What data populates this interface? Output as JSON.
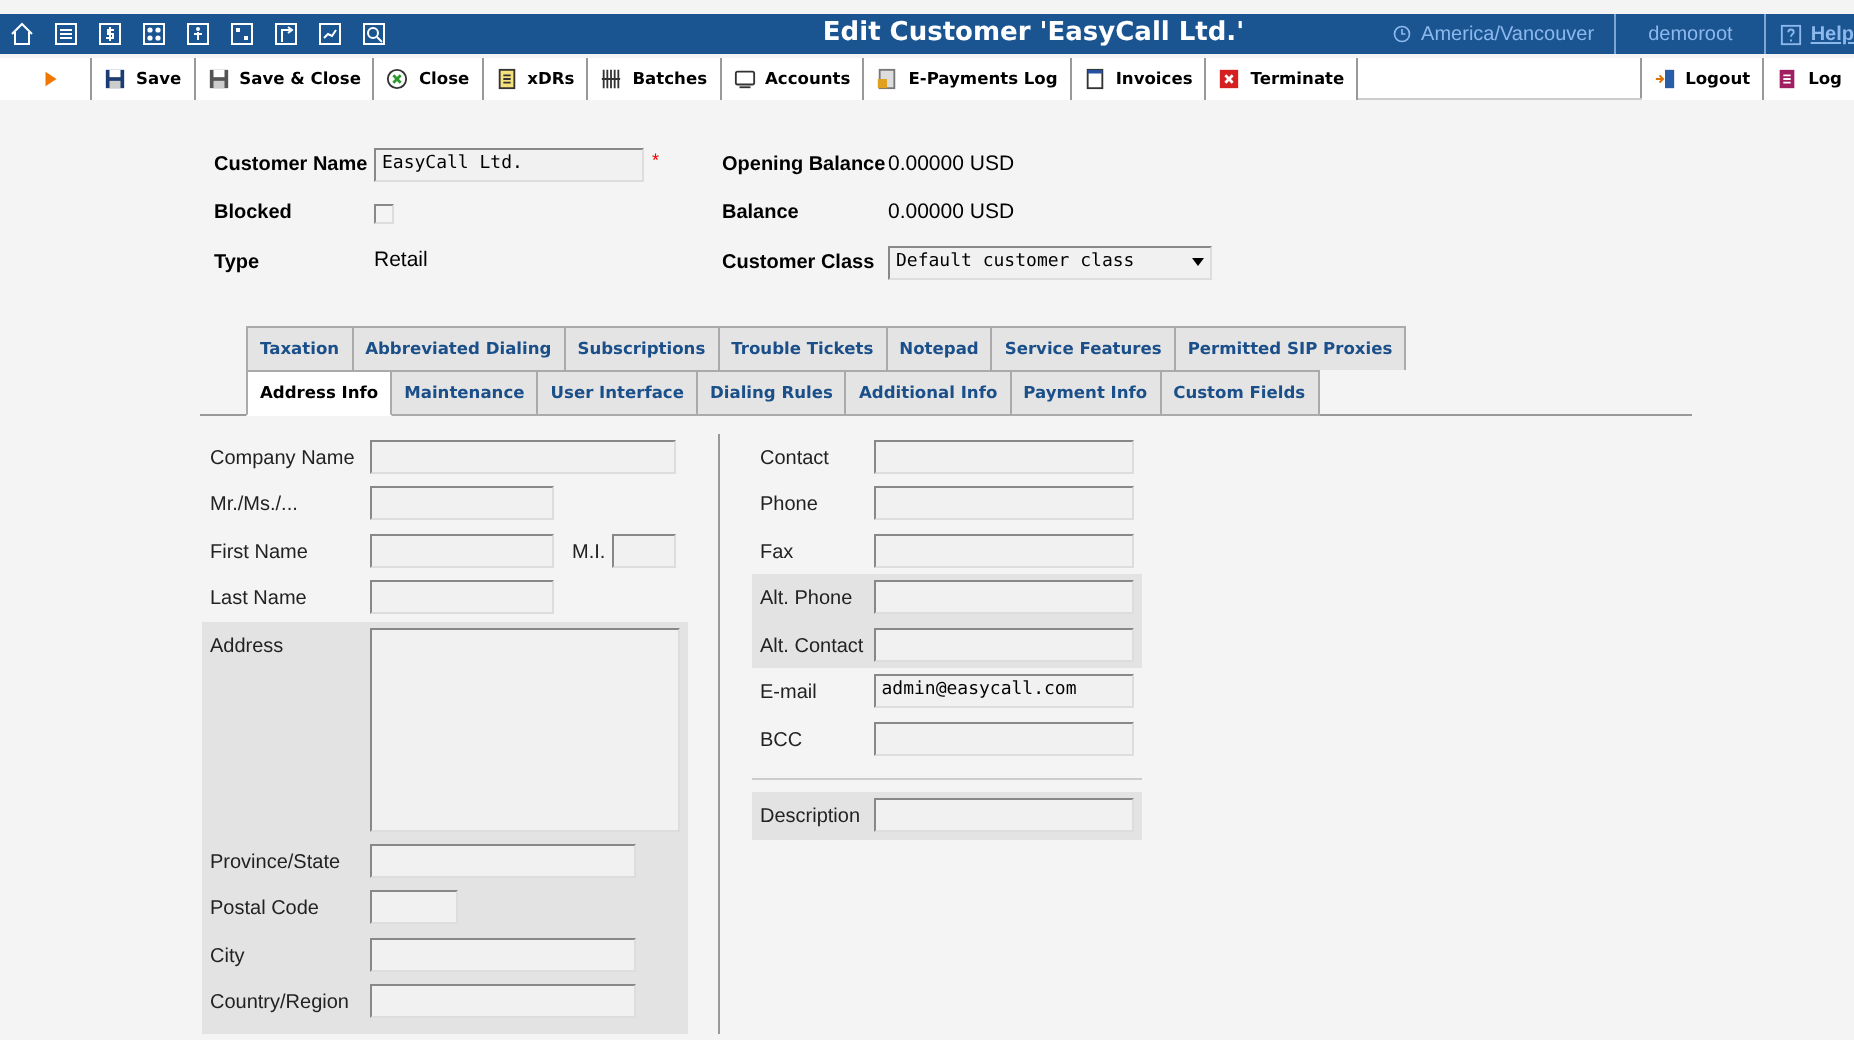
{
  "nav_icons": [
    {
      "kind": "home"
    },
    {
      "kind": "list"
    },
    {
      "kind": "dollar"
    },
    {
      "kind": "grid"
    },
    {
      "kind": "person"
    },
    {
      "kind": "nodes"
    },
    {
      "kind": "arrow"
    },
    {
      "kind": "chart"
    },
    {
      "kind": "search"
    }
  ],
  "title": "Edit Customer 'EasyCall Ltd.'",
  "timezone": "America/Vancouver",
  "user": "demoroot",
  "help": "Help",
  "toolbar": [
    {
      "kind": "play"
    },
    {
      "kind": "save",
      "label": "Save"
    },
    {
      "kind": "saveclose",
      "label": "Save & Close"
    },
    {
      "kind": "close",
      "label": "Close"
    },
    {
      "kind": "doc",
      "label": "xDRs"
    },
    {
      "kind": "batches",
      "label": "Batches"
    },
    {
      "kind": "accounts",
      "label": "Accounts"
    },
    {
      "kind": "payments",
      "label": "E-Payments Log"
    },
    {
      "kind": "invoice",
      "label": "Invoices"
    },
    {
      "kind": "terminate",
      "label": "Terminate"
    }
  ],
  "toolbar_right": [
    {
      "kind": "logout",
      "label": "Logout"
    },
    {
      "kind": "log",
      "label": "Log"
    }
  ],
  "header": {
    "customer_name": {
      "label": "Customer Name",
      "value": "EasyCall Ltd.",
      "required_mark": "*"
    },
    "blocked": {
      "label": "Blocked",
      "checked": false
    },
    "type": {
      "label": "Type",
      "value": "Retail"
    },
    "opening_balance": {
      "label": "Opening Balance",
      "value": "0.00000 USD"
    },
    "balance": {
      "label": "Balance",
      "value": "0.00000 USD"
    },
    "customer_class": {
      "label": "Customer Class",
      "value": "Default customer class"
    }
  },
  "tab_rows": [
    [
      {
        "label": "Taxation",
        "selected": false
      },
      {
        "label": "Abbreviated Dialing",
        "selected": false
      },
      {
        "label": "Subscriptions",
        "selected": false
      },
      {
        "label": "Trouble Tickets",
        "selected": false
      },
      {
        "label": "Notepad",
        "selected": false
      },
      {
        "label": "Service Features",
        "selected": false
      },
      {
        "label": "Permitted SIP Proxies",
        "selected": false
      }
    ],
    [
      {
        "label": "Address Info",
        "selected": true
      },
      {
        "label": "Maintenance",
        "selected": false
      },
      {
        "label": "User Interface",
        "selected": false
      },
      {
        "label": "Dialing Rules",
        "selected": false
      },
      {
        "label": "Additional Info",
        "selected": false
      },
      {
        "label": "Payment Info",
        "selected": false
      },
      {
        "label": "Custom Fields",
        "selected": false
      }
    ]
  ],
  "left_fields": [
    {
      "label": "Company Name",
      "kind": "wide",
      "shaded": false
    },
    {
      "label": "Mr./Ms./...",
      "kind": "medium",
      "shaded": false
    },
    {
      "label": "First Name",
      "kind": "medium",
      "shaded": false,
      "extra": {
        "label": "M.I.",
        "kind": "short"
      }
    },
    {
      "label": "Last Name",
      "kind": "medium",
      "shaded": false
    },
    {
      "label": "Address",
      "kind": "textarea",
      "shaded": true
    },
    {
      "label": "Province/State",
      "kind": "long",
      "shaded": true
    },
    {
      "label": "Postal Code",
      "kind": "tiny",
      "shaded": true
    },
    {
      "label": "City",
      "kind": "long",
      "shaded": true
    },
    {
      "label": "Country/Region",
      "kind": "long",
      "shaded": true
    }
  ],
  "right_fields": [
    {
      "label": "Contact",
      "kind": "long",
      "shaded": false
    },
    {
      "label": "Phone",
      "kind": "long",
      "shaded": false
    },
    {
      "label": "Fax",
      "kind": "long",
      "shaded": false
    },
    {
      "label": "Alt. Phone",
      "kind": "long",
      "shaded": true
    },
    {
      "label": "Alt. Contact",
      "kind": "long",
      "shaded": true
    },
    {
      "label": "E-mail",
      "kind": "long",
      "shaded": false,
      "value": "admin@easycall.com"
    },
    {
      "label": "BCC",
      "kind": "long",
      "shaded": false
    },
    {
      "label": "Description",
      "kind": "long",
      "shaded": true,
      "divider_before": true
    }
  ]
}
